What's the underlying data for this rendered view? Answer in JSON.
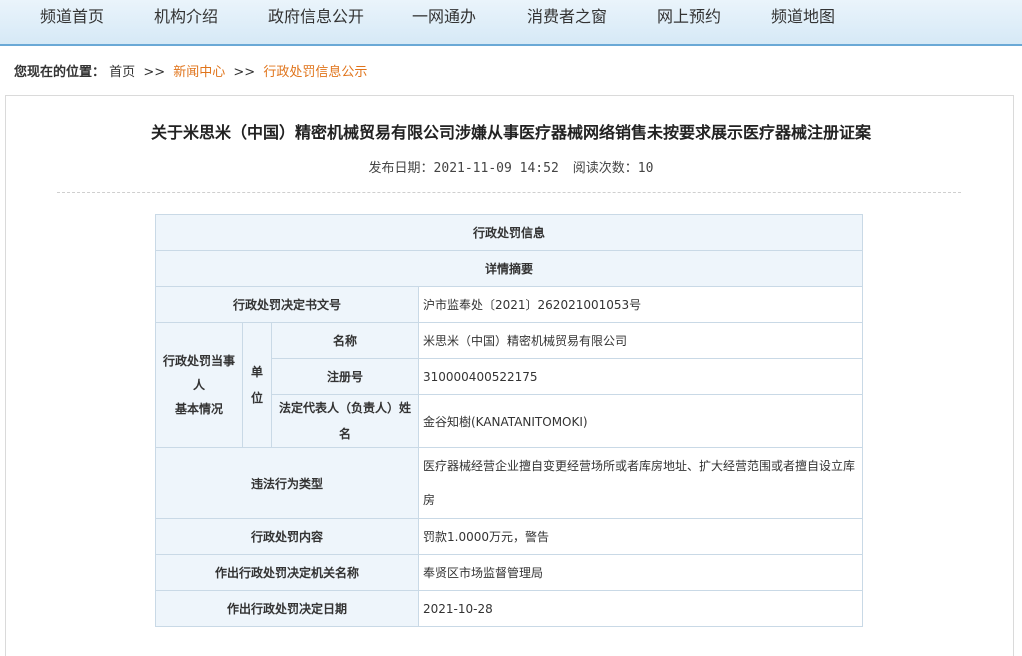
{
  "nav": {
    "items": [
      "频道首页",
      "机构介绍",
      "政府信息公开",
      "一网通办",
      "消费者之窗",
      "网上预约",
      "频道地图"
    ]
  },
  "breadcrumb": {
    "label": "您现在的位置：",
    "home": "首页",
    "sep": ">>",
    "news": "新闻中心",
    "current": "行政处罚信息公示"
  },
  "article": {
    "title": "关于米思米（中国）精密机械贸易有限公司涉嫌从事医疗器械网络销售未按要求展示医疗器械注册证案",
    "date_label": "发布日期：",
    "date": "2021-11-09 14:52",
    "views_label": "阅读次数：",
    "views": "10"
  },
  "table": {
    "header": "行政处罚信息",
    "subheader": "详情摘要",
    "doc_no_label": "行政处罚决定书文号",
    "doc_no": "沪市监奉处〔2021〕262021001053号",
    "party_label_1": "行政处罚当事",
    "party_label_2": "人",
    "party_label_3": "基本情况",
    "unit_label_1": "单",
    "unit_label_2": "位",
    "name_label": "名称",
    "name": "米思米（中国）精密机械贸易有限公司",
    "reg_label": "注册号",
    "reg": "310000400522175",
    "rep_label": "法定代表人（负责人）姓名",
    "rep": "金谷知樹(KANATANITOMOKI)",
    "violation_label": "违法行为类型",
    "violation": "医疗器械经营企业擅自变更经营场所或者库房地址、扩大经营范围或者擅自设立库房",
    "penalty_label": "行政处罚内容",
    "penalty": "罚款1.0000万元，警告",
    "org_label": "作出行政处罚决定机关名称",
    "org": "奉贤区市场监督管理局",
    "decision_date_label": "作出行政处罚决定日期",
    "decision_date": "2021-10-28"
  }
}
